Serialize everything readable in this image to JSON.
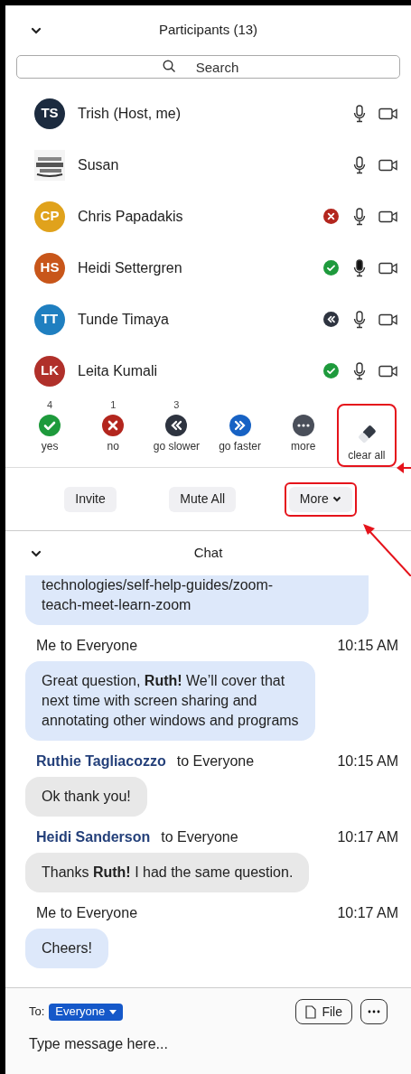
{
  "participants_panel": {
    "title": "Participants (13)",
    "search": {
      "placeholder": "Search"
    },
    "participants": [
      {
        "avatar": {
          "initials": "TS",
          "color": "#1c2b3f"
        },
        "name": "Trish (Host, me)",
        "speaking": false
      },
      {
        "name": "Susan",
        "speaking": false
      },
      {
        "avatar": {
          "initials": "CP",
          "color": "#e0a21c"
        },
        "name": "Chris Papadakis",
        "status": {
          "kind": "no"
        },
        "speaking": false
      },
      {
        "avatar": {
          "initials": "HS",
          "color": "#c8561a"
        },
        "name": "Heidi Settergren",
        "status": {
          "kind": "yes"
        },
        "speaking": true
      },
      {
        "avatar": {
          "initials": "TT",
          "color": "#1f7fc0"
        },
        "name": "Tunde Timaya",
        "status": {
          "kind": "slower"
        },
        "speaking": false
      },
      {
        "avatar": {
          "initials": "LK",
          "color": "#b0302a"
        },
        "name": "Leita Kumali",
        "status": {
          "kind": "yes"
        },
        "speaking": false
      }
    ],
    "reactions": [
      {
        "kind": "yes",
        "label": "yes",
        "count": "4",
        "highlighted": false
      },
      {
        "kind": "no",
        "label": "no",
        "count": "1",
        "highlighted": false
      },
      {
        "kind": "slower",
        "label": "go slower",
        "count": "3",
        "highlighted": false
      },
      {
        "kind": "faster",
        "label": "go faster",
        "highlighted": false
      },
      {
        "kind": "more",
        "label": "more",
        "highlighted": false
      },
      {
        "kind": "clear",
        "label": "clear all",
        "highlighted": true
      }
    ],
    "buttons": [
      {
        "label": "Invite",
        "dropdown": false,
        "highlighted": false
      },
      {
        "label": "Mute All",
        "dropdown": false,
        "highlighted": false
      },
      {
        "label": "More",
        "dropdown": true,
        "highlighted": true
      }
    ]
  },
  "chat_panel": {
    "title": "Chat",
    "messages": [
      {
        "mine": true,
        "lines": [
          "technologies/self-help-guides/zoom-",
          "teach-meet-learn-zoom"
        ]
      },
      {
        "mine": true,
        "sender": "Me to Everyone",
        "time": "10:15 AM",
        "lines": [
          "Great question, **Ruth!**  We’ll cover that",
          "next time with screen sharing and",
          "annotating other windows and programs"
        ]
      },
      {
        "mine": false,
        "sender": "Ruthie Tagliacozzo",
        "recipient": "to Everyone",
        "time": "10:15 AM",
        "lines": [
          "Ok thank you!"
        ]
      },
      {
        "mine": false,
        "sender": "Heidi Sanderson",
        "recipient": "to Everyone",
        "time": "10:17 AM",
        "lines": [
          "Thanks **Ruth!** I had the same question."
        ]
      },
      {
        "mine": true,
        "sender": "Me to Everyone",
        "time": "10:17 AM",
        "lines": [
          "Cheers!"
        ]
      }
    ],
    "to_label": "To:",
    "recipient": "Everyone",
    "file_button": "File",
    "input": {
      "placeholder": "Type message here..."
    }
  }
}
